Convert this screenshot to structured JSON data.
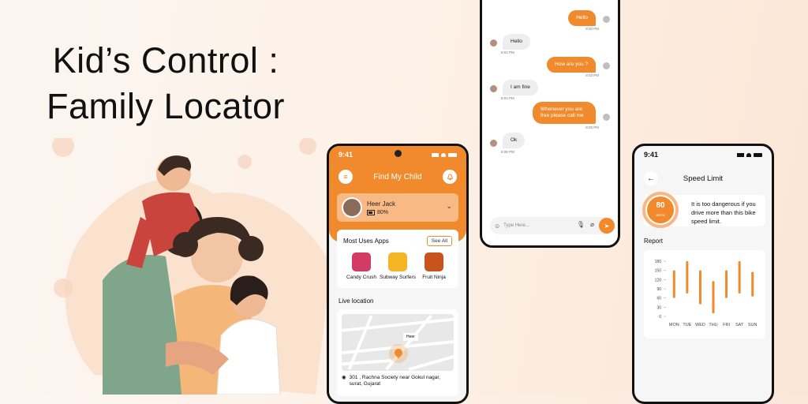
{
  "headline": {
    "line1": "Kid’s Control :",
    "line2": "Family Locator"
  },
  "colors": {
    "accent": "#f08a2c",
    "accent_light": "#f9b985",
    "bg": "#fdf1e7"
  },
  "phone_home": {
    "status_time": "9:41",
    "title": "Find My Child",
    "child": {
      "name": "Heer Jack",
      "battery": "80%"
    },
    "apps_section": {
      "title": "Most Uses Apps",
      "see_all": "See All",
      "apps": [
        {
          "label": "Candy Crush",
          "color": "#d23b63"
        },
        {
          "label": "Subway Surfers",
          "color": "#f3b425"
        },
        {
          "label": "Fruit Ninja",
          "color": "#c7541e"
        }
      ]
    },
    "live_location": {
      "title": "Live location",
      "pin_label": "Heer",
      "address": "301 , Rachna Society near Gokul nagar, surat, Gujarat"
    }
  },
  "phone_chat": {
    "messages": [
      {
        "dir": "out",
        "text": "Hello",
        "time": "8:00 PM"
      },
      {
        "dir": "in",
        "text": "Hello",
        "time": "8:02 PM"
      },
      {
        "dir": "out",
        "text": "How are you ?",
        "time": "8:03 PM"
      },
      {
        "dir": "in",
        "text": "I am fine",
        "time": "8:04 PM"
      },
      {
        "dir": "out",
        "text": "Whenever you are free please call me",
        "time": "8:05 PM"
      },
      {
        "dir": "in",
        "text": "Ok",
        "time": "8:06 PM"
      }
    ],
    "input_placeholder": "Type Here..."
  },
  "phone_speed": {
    "status_time": "9:41",
    "title": "Speed Limit",
    "speed_value": "80",
    "speed_unit": "M/P/H",
    "warning": "It is too dangerous if you drive more than this bike speed limit.",
    "report_title": "Report"
  },
  "chart_data": {
    "type": "bar",
    "title": "Report",
    "categories": [
      "MON",
      "TUE",
      "WED",
      "THU",
      "FRI",
      "SAT",
      "SUN"
    ],
    "ranges": [
      [
        60,
        150
      ],
      [
        75,
        180
      ],
      [
        40,
        150
      ],
      [
        10,
        115
      ],
      [
        60,
        150
      ],
      [
        75,
        180
      ],
      [
        65,
        145
      ]
    ],
    "yticks": [
      180,
      150,
      120,
      90,
      60,
      30,
      0
    ],
    "ylim": [
      0,
      180
    ],
    "color": "#f08a2c"
  }
}
